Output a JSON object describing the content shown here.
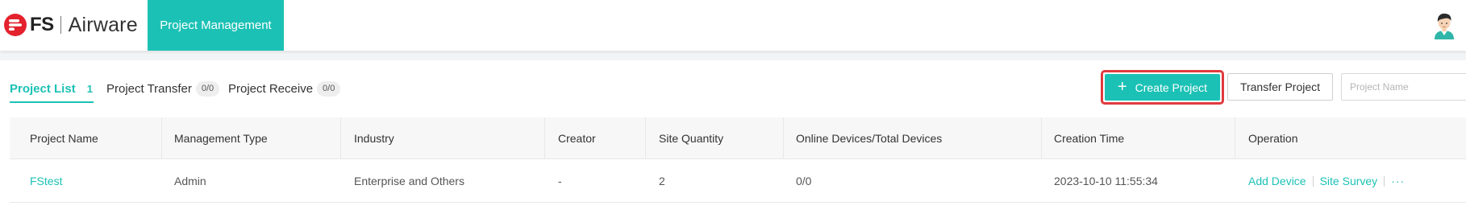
{
  "brand": {
    "logo_text": "FS",
    "product": "Airware",
    "accent": "#1cc1b5",
    "logo_red": "#e3222e"
  },
  "nav": {
    "active_item": "Project Management"
  },
  "user": {
    "avatar": "user-avatar-icon"
  },
  "tabs": [
    {
      "label": "Project List",
      "count": "1"
    },
    {
      "label": "Project Transfer",
      "badge": "0/0"
    },
    {
      "label": "Project Receive",
      "badge": "0/0"
    }
  ],
  "toolbar": {
    "create_label": "Create Project",
    "create_icon": "plus-icon",
    "transfer_label": "Transfer Project",
    "search_placeholder": "Project Name",
    "highlight_color": "#e03a3e"
  },
  "table": {
    "columns": [
      "Project Name",
      "Management Type",
      "Industry",
      "Creator",
      "Site Quantity",
      "Online Devices/Total Devices",
      "Creation Time",
      "Operation"
    ],
    "rows": [
      {
        "project_name": "FStest",
        "management_type": "Admin",
        "industry": "Enterprise and Others",
        "creator": "-",
        "site_quantity": "2",
        "devices": "0/0",
        "creation_time": "2023-10-10 11:55:34",
        "operations": [
          "Add Device",
          "Site Survey",
          "···"
        ]
      }
    ]
  }
}
